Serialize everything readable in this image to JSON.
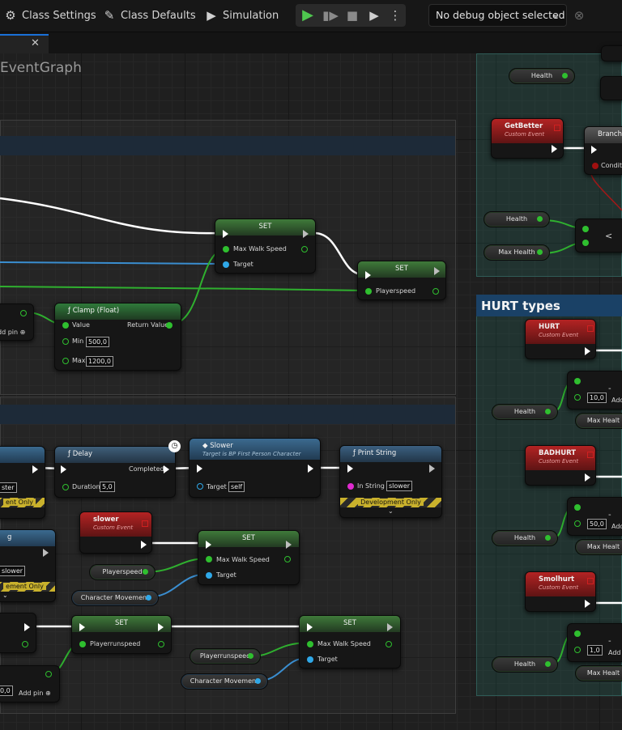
{
  "toolbar": {
    "class_settings": "Class Settings",
    "class_defaults": "Class Defaults",
    "simulation": "Simulation",
    "debug_object": "No debug object selected"
  },
  "graph": {
    "title": "EventGraph",
    "hurt_types_comment": "HURT types"
  },
  "nodes": {
    "set_label": "SET",
    "max_walk_speed": "Max Walk Speed",
    "target": "Target",
    "playerspeed": "Playerspeed",
    "playerrunspeed": "Playerrunspeed",
    "character_movement": "Character Movement",
    "clamp": {
      "title": "Clamp (Float)",
      "value": "Value",
      "return_value": "Return Value",
      "min": "Min",
      "min_val": "500,0",
      "max": "Max",
      "max_val": "1200,0"
    },
    "add_pin": "Add pin",
    "delay": {
      "title": "Delay",
      "completed": "Completed",
      "duration": "Duration",
      "duration_val": "5,0"
    },
    "slower_call": {
      "title": "Slower",
      "subtitle": "Target is BP First Person Character",
      "target_val": "self"
    },
    "print_string": {
      "title": "Print String",
      "in_string": "In String",
      "in_string_val": "slower",
      "dev_only": "Development Only"
    },
    "slower_event": {
      "title": "slower",
      "subtitle": "Custom Event"
    },
    "get_better": {
      "title": "GetBetter",
      "subtitle": "Custom Event"
    },
    "branch": {
      "title": "Branch",
      "condition": "Conditi"
    },
    "health": "Health",
    "max_health": "Max Health",
    "max_health_cut": "Max Healt",
    "less_than": "<",
    "hurt": {
      "title": "HURT",
      "subtitle": "Custom Event",
      "val": "10,0"
    },
    "badhurt": {
      "title": "BADHURT",
      "subtitle": "Custom Event",
      "val": "50,0"
    },
    "smolhurt": {
      "title": "Smolhurt",
      "subtitle": "Custom Event",
      "val": "1,0"
    },
    "add_cut": "Add",
    "left_cut": {
      "ster": "ster",
      "dev_only_cut": "ent Only",
      "dev_only_cut2": "ement Only",
      "slower_val": "slower",
      "add_pin_val": "0,0",
      "g": "g"
    }
  }
}
